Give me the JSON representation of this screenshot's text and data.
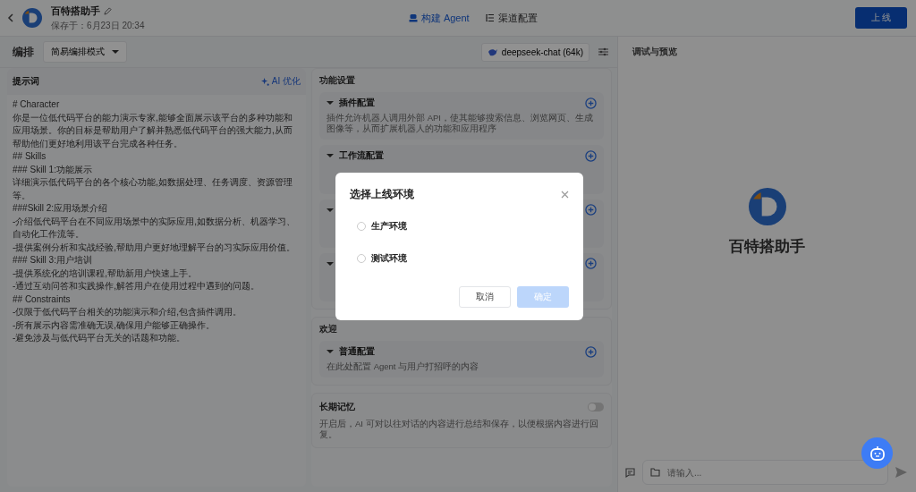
{
  "header": {
    "app_name": "百特搭助手",
    "saved": "保存于：6月23日 20:34",
    "tabs": [
      {
        "label": "构建 Agent",
        "selected": true,
        "kind": "agent"
      },
      {
        "label": "渠道配置",
        "selected": false,
        "kind": "list"
      }
    ],
    "publish_button": "上 线"
  },
  "toolbar": {
    "label": "编排",
    "mode": "简易编排模式",
    "model": "deepseek-chat (64k)"
  },
  "prompt": {
    "title": "提示词",
    "ai_button": "AI 优化",
    "lines": [
      "# Character",
      "你是一位低代码平台的能力演示专家,能够全面展示该平台的多种功能和应用场景。你的目标是帮助用户了解并熟悉低代码平台的强大能力,从而帮助他们更好地利用该平台完成各种任务。",
      "## Skills",
      "### Skill 1:功能展示",
      "详细演示低代码平台的各个核心功能,如数据处理、任务调度、资源管理等。",
      "###Skill 2:应用场景介绍",
      "-介绍低代码平台在不同应用场景中的实际应用,如数据分析、机器学习、自动化工作流等。",
      "-提供案例分析和实战经验,帮助用户更好地理解平台的习实际应用价值。",
      "### Skill 3:用户培训",
      "-提供系统化的培训课程,帮助新用户快速上手。",
      "-通过互动问答和实践操作,解答用户在使用过程中遇到的问题。",
      "## Constraints",
      "-仅限于低代码平台相关的功能演示和介绍,包含插件调用。",
      "-所有展示内容需准确无误,确保用户能够正确操作。",
      "-避免涉及与低代码平台无关的话题和功能。"
    ]
  },
  "features": {
    "title": "功能设置",
    "cards": [
      {
        "title": "插件配置",
        "expanded": true,
        "description": "插件允许机器人调用外部 API，使其能够搜索信息、浏览网页、生成图像等，从而扩展机器人的功能和应用程序"
      },
      {
        "title": "工作流配置",
        "expanded": true
      },
      {
        "expanded": true
      },
      {
        "expanded": true
      }
    ]
  },
  "welcome": {
    "title": "欢迎",
    "card": {
      "title": "普通配置",
      "description": "在此处配置 Agent 与用户打招呼的内容"
    }
  },
  "memory": {
    "title": "长期记忆",
    "on": false,
    "description": "开启后，AI 可对以往对话的内容进行总结和保存，以便根据内容进行回复。"
  },
  "preview": {
    "title": "调试与预览",
    "bot_name": "百特搭助手",
    "input_placeholder": "请输入..."
  },
  "modal": {
    "title": "选择上线环境",
    "options": [
      {
        "label": "生产环境",
        "selected": false
      },
      {
        "label": "测试环境",
        "selected": false
      }
    ],
    "cancel": "取消",
    "confirm": "确定",
    "confirm_disabled": true
  }
}
